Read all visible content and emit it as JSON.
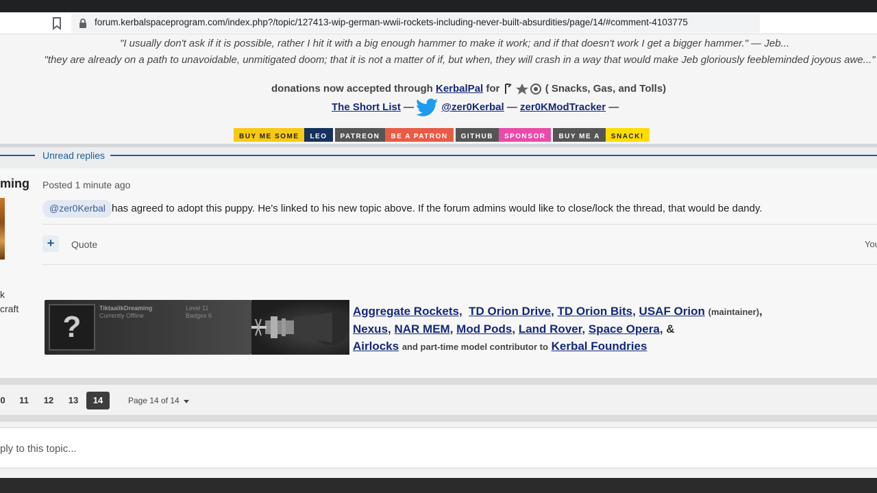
{
  "browser": {
    "url": "forum.kerbalspaceprogram.com/index.php?/topic/127413-wip-german-wwii-rockets-including-never-built-absurdities/page/14/#comment-4103775"
  },
  "signature_top": {
    "quote1": "\"I usually don't ask if it is possible, rather I hit it with a big enough hammer to make it work; and if that doesn't work I get a bigger hammer.\"  — Jeb...",
    "quote2": "\"they are already on a path to unavoidable, unmitigated doom; that it is not a matter of if, but when, they will crash in a way that would make Jeb gloriously feebleminded joyous awe...\"",
    "donations_prefix": "donations now accepted through ",
    "donations_link": "KerbalPal",
    "donations_for": " for ",
    "donations_suffix": " ( Snacks, Gas, and Tolls)",
    "short_list": "The Short List",
    "dash1": " — ",
    "twitter_handle": "@zer0Kerbal",
    "dash2": "  — ",
    "mod_tracker": "zer0KModTracker",
    "dash3": " —",
    "badges": [
      {
        "left": "BUY ME SOME",
        "right": "LEO",
        "lc": "#f6c915",
        "rc": "#14325c",
        "ltc": "#222",
        "rtc": "#ffffff"
      },
      {
        "left": "PATREON",
        "right": "BE A PATRON",
        "lc": "#555555",
        "rc": "#e85b46",
        "ltc": "#fff",
        "rtc": "#ffffff"
      },
      {
        "left": "GITHUB",
        "right": "SPONSOR",
        "lc": "#555555",
        "rc": "#ea4aaa",
        "ltc": "#fff",
        "rtc": "#ffffff"
      },
      {
        "left": "BUY ME A",
        "right": "SNACK!",
        "lc": "#555555",
        "rc": "#ffdd00",
        "ltc": "#fff",
        "rtc": "#222222"
      }
    ]
  },
  "divider": {
    "label": "Unread replies"
  },
  "post": {
    "author_partial": "ming",
    "posted_prefix": "Posted ",
    "posted_time": "1 minute ago",
    "mention": "@zer0Kerbal",
    "message": "has agreed to adopt this puppy.  He's linked to his new topic above.  If the forum admins would like to close/lock the thread, that would be dandy.",
    "quote_label": "Quote",
    "right_partial": "You",
    "side_line1": "k",
    "side_line2": "craft",
    "sig_card": {
      "question": "?",
      "name": "TiktaalikDreaming",
      "status": "Currently Offline",
      "level": "Level  11",
      "badges": "Badges  6"
    },
    "mods": {
      "aggregate": "Aggregate Rockets",
      "orion_drive": "TD Orion Drive",
      "orion_bits": "TD Orion Bits",
      "usaf": "USAF Orion",
      "maintainer": "(maintainer)",
      "nexus": "Nexus",
      "nar": "NAR MEM",
      "modpods": "Mod Pods",
      "landrover": "Land Rover",
      "spaceopera": "Space Opera",
      "amp": ", &",
      "airlocks": "Airlocks",
      "contrib": "and part-time model contributor to",
      "foundries": "Kerbal Foundries"
    }
  },
  "pagination": {
    "pages": [
      "0",
      "11",
      "12",
      "13",
      "14"
    ],
    "active": "14",
    "page_of": "Page 14 of 14"
  },
  "reply": {
    "placeholder": "ply to this topic..."
  }
}
